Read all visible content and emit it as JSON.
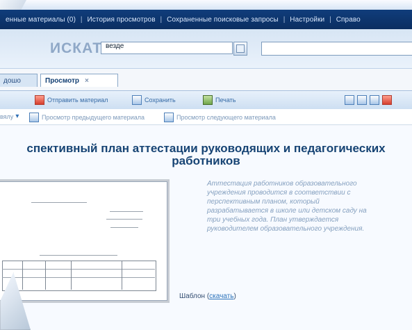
{
  "top_nav": {
    "items": [
      "енные материалы (0)",
      "История просмотров",
      "Сохраненные поисковые запросы",
      "Настройки",
      "Справо"
    ]
  },
  "search": {
    "label": "ИСКАТЬ",
    "scope_value": "везде"
  },
  "tabs": {
    "items": [
      {
        "label": "дошо"
      },
      {
        "label": "Просмотр"
      }
    ]
  },
  "toolbar": {
    "items": [
      "Отправить материал",
      "Сохранить",
      "Печать"
    ]
  },
  "subbar": {
    "left_value": "вялу",
    "items": [
      "Просмотр предыдущего материала",
      "Просмотр следующего материала"
    ]
  },
  "document": {
    "title": "спективный план аттестации руководящих и педагогических работников",
    "description": "Аттестация работников образовательного учреждения проводится в соответствии с перспективным планом, который разрабатывается в школе или детском саду на три учебных года. План утверждается руководителем образовательного учреждения.",
    "template_label": "Шаблон (",
    "template_link": "скачать",
    "template_end": ")"
  },
  "colors": {
    "header_blue": "#0b2e61",
    "accent_blue": "#2c73bb",
    "light_panel": "#d7e5f4"
  },
  "icons": {
    "search": "search-icon",
    "send": "send-icon",
    "save": "save-icon",
    "print": "print-icon",
    "window": "window-icon",
    "close": "close-icon",
    "prev": "previous-icon",
    "next": "next-icon",
    "dropdown": "chevron-down-icon"
  }
}
